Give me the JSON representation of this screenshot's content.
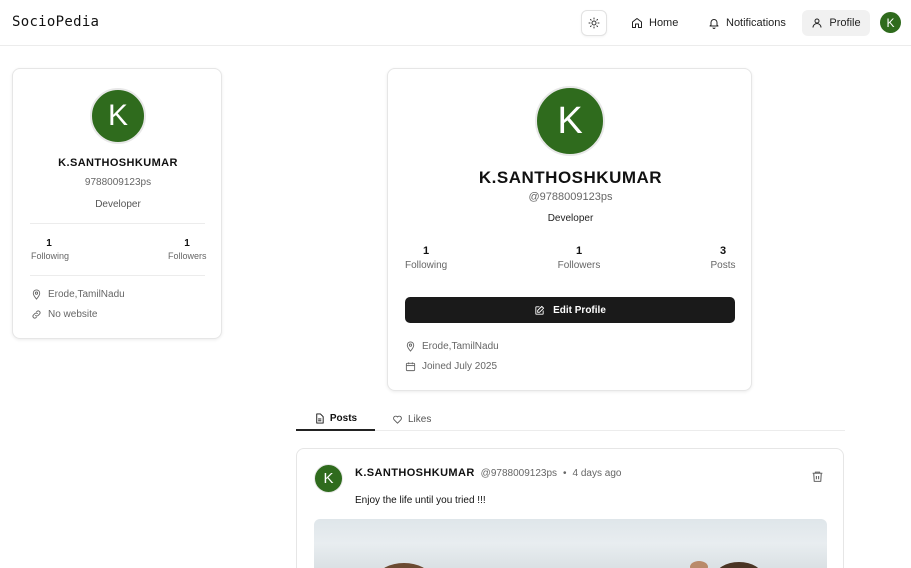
{
  "nav": {
    "brand": "SocioPedia",
    "home_label": "Home",
    "notifications_label": "Notifications",
    "profile_label": "Profile",
    "avatar_initial": "K"
  },
  "sidebar_profile": {
    "avatar_initial": "K",
    "name": "K.SANTHOSHKUMAR",
    "handle": "9788009123ps",
    "bio": "Developer",
    "following_count": "1",
    "following_label": "Following",
    "followers_count": "1",
    "followers_label": "Followers",
    "location": "Erode,TamilNadu",
    "website": "No website"
  },
  "profile": {
    "avatar_initial": "K",
    "name": "K.SANTHOSHKUMAR",
    "handle": "@9788009123ps",
    "bio": "Developer",
    "following_count": "1",
    "following_label": "Following",
    "followers_count": "1",
    "followers_label": "Followers",
    "posts_count": "3",
    "posts_label": "Posts",
    "edit_button_label": "Edit Profile",
    "location": "Erode,TamilNadu",
    "joined": "Joined July 2025"
  },
  "tabs": [
    {
      "label": "Posts",
      "icon": "file-text-icon",
      "active": true
    },
    {
      "label": "Likes",
      "icon": "heart-icon",
      "active": false
    }
  ],
  "post": {
    "avatar_initial": "K",
    "author_name": "K.SANTHOSHKUMAR",
    "author_handle": "@9788009123ps",
    "separator": "•",
    "time": "4 days ago",
    "content": "Enjoy the life until you tried !!!"
  },
  "colors": {
    "avatar_bg": "#2f6b1d",
    "primary_button": "#1a1a1a",
    "active_nav_bg": "#f1f1f1"
  }
}
